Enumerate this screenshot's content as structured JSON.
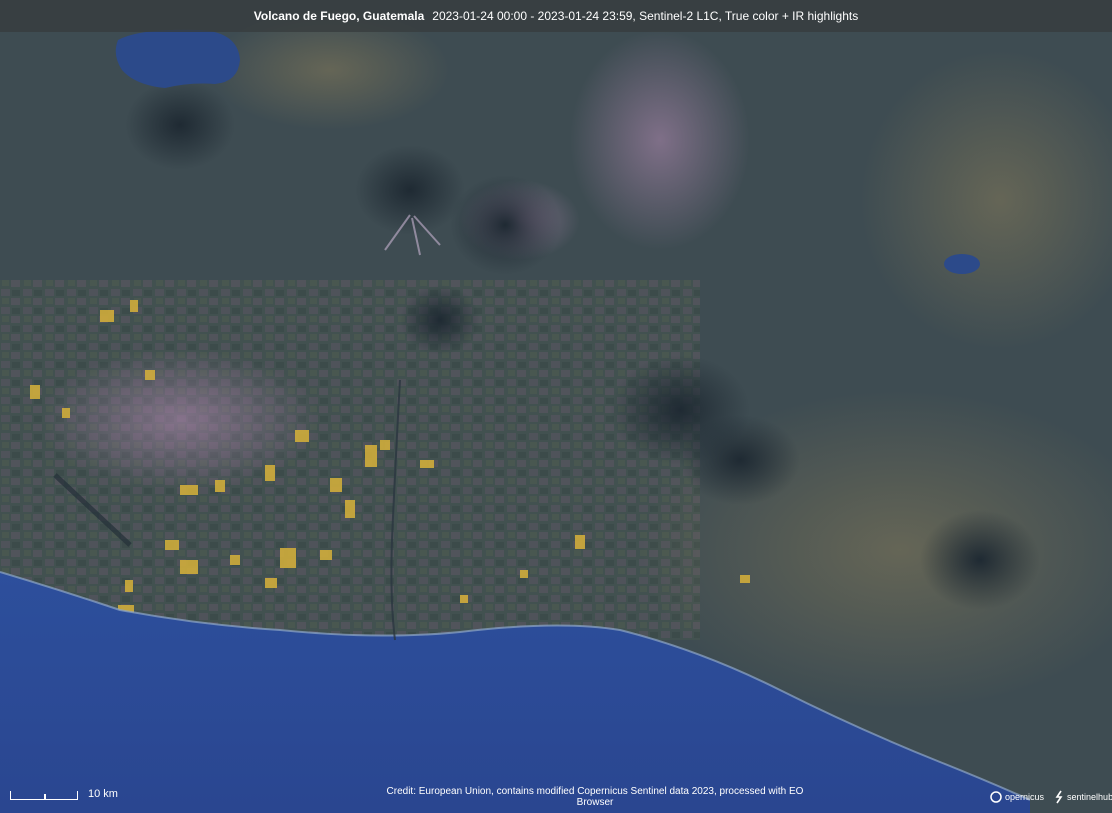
{
  "title": {
    "location": "Volcano de Fuego, Guatemala",
    "details": "2023-01-24 00:00 - 2023-01-24 23:59, Sentinel-2 L1C, True color + IR highlights"
  },
  "scale": {
    "label": "10 km"
  },
  "credit": "Credit: European Union, contains modified Copernicus Sentinel data 2023, processed with EO Browser",
  "logos": {
    "copernicus": "opernicus",
    "sentinelhub": "sentinelhub"
  },
  "colors": {
    "ocean": "#2c4c98",
    "land": "#3e4c52",
    "crop_highlight": "#d8b23a",
    "urban": "#b48cb4"
  }
}
